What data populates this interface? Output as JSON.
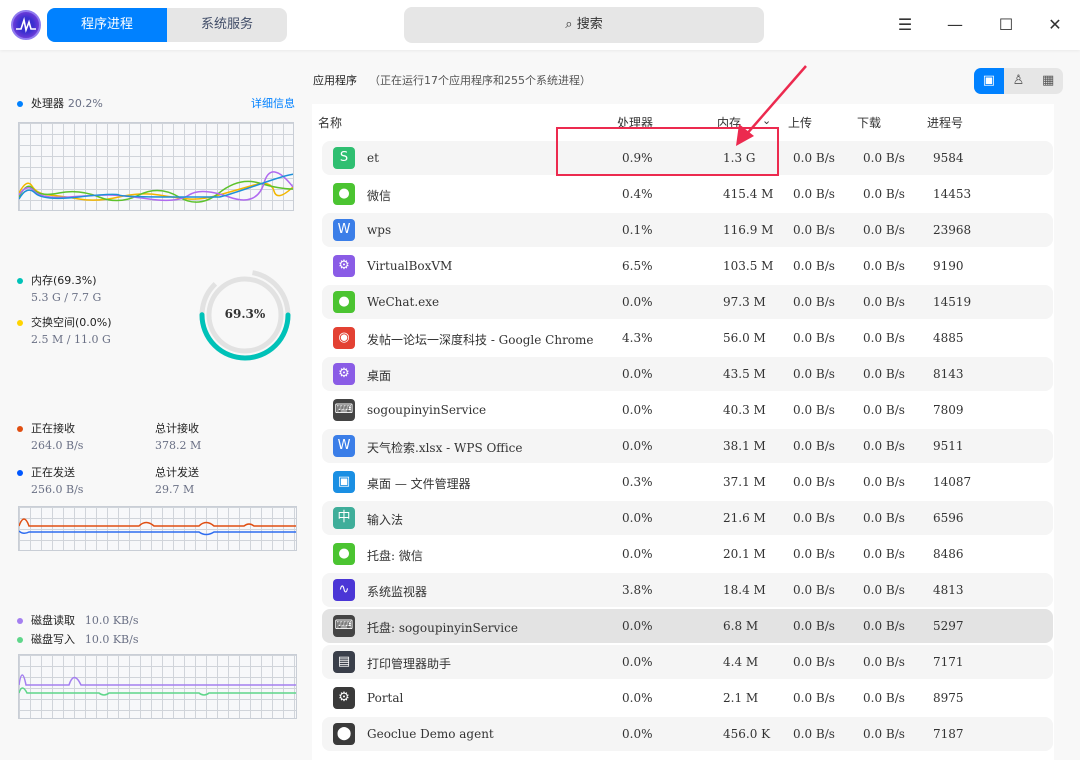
{
  "titlebar": {
    "tabs": [
      "程序进程",
      "系统服务"
    ],
    "search": "搜索",
    "menu": "☰",
    "min": "—",
    "max": "☐",
    "close": "✕"
  },
  "cpu": {
    "label": "处理器",
    "value": "20.2%",
    "detail": "详细信息"
  },
  "memory": {
    "label": "内存(69.3%)",
    "value": "5.3 G / 7.7 G",
    "swap_label": "交换空间(0.0%)",
    "swap_value": "2.5 M / 11.0 G",
    "ring_text": "69.3%",
    "percent": 69.3
  },
  "network": {
    "recv_label": "正在接收",
    "recv": "264.0 B/s",
    "total_recv_label": "总计接收",
    "total_recv": "378.2 M",
    "send_label": "正在发送",
    "send": "256.0 B/s",
    "total_send_label": "总计发送",
    "total_send": "29.7 M"
  },
  "disk": {
    "read_label": "磁盘读取",
    "read": "10.0 KB/s",
    "write_label": "磁盘写入",
    "write": "10.0 KB/s"
  },
  "main": {
    "title": "应用程序",
    "subtitle": "（正在运行17个应用程序和255个系统进程）",
    "columns": [
      "名称",
      "处理器",
      "内存",
      "上传",
      "下载",
      "进程号"
    ],
    "rows": [
      {
        "name": "et",
        "cpu": "0.9%",
        "mem": "1.3 G",
        "up": "0.0 B/s",
        "down": "0.0 B/s",
        "pid": "9584",
        "icon": "et-icon",
        "color": "#2fbf71",
        "glyph": "S"
      },
      {
        "name": "微信",
        "cpu": "0.4%",
        "mem": "415.4 M",
        "up": "0.0 B/s",
        "down": "0.0 B/s",
        "pid": "14453",
        "icon": "wechat-icon",
        "color": "#4bc431",
        "glyph": "●"
      },
      {
        "name": "wps",
        "cpu": "0.1%",
        "mem": "116.9 M",
        "up": "0.0 B/s",
        "down": "0.0 B/s",
        "pid": "23968",
        "icon": "wps-icon",
        "color": "#3b7ee8",
        "glyph": "W"
      },
      {
        "name": "VirtualBoxVM",
        "cpu": "6.5%",
        "mem": "103.5 M",
        "up": "0.0 B/s",
        "down": "0.0 B/s",
        "pid": "9190",
        "icon": "gear-app-icon",
        "color": "#8a5ce6",
        "glyph": "⚙"
      },
      {
        "name": "WeChat.exe",
        "cpu": "0.0%",
        "mem": "97.3 M",
        "up": "0.0 B/s",
        "down": "0.0 B/s",
        "pid": "14519",
        "icon": "wechat-icon",
        "color": "#4bc431",
        "glyph": "●"
      },
      {
        "name": "发帖一论坛一深度科技 - Google Chrome",
        "cpu": "4.3%",
        "mem": "56.0 M",
        "up": "0.0 B/s",
        "down": "0.0 B/s",
        "pid": "4885",
        "icon": "chrome-icon",
        "color": "#e34133",
        "glyph": "◉"
      },
      {
        "name": "桌面",
        "cpu": "0.0%",
        "mem": "43.5 M",
        "up": "0.0 B/s",
        "down": "0.0 B/s",
        "pid": "8143",
        "icon": "gear-app-icon",
        "color": "#8a5ce6",
        "glyph": "⚙"
      },
      {
        "name": "sogoupinyinService",
        "cpu": "0.0%",
        "mem": "40.3 M",
        "up": "0.0 B/s",
        "down": "0.0 B/s",
        "pid": "7809",
        "icon": "keyboard-icon",
        "color": "#444",
        "glyph": "⌨"
      },
      {
        "name": "天气检索.xlsx - WPS Office",
        "cpu": "0.0%",
        "mem": "38.1 M",
        "up": "0.0 B/s",
        "down": "0.0 B/s",
        "pid": "9511",
        "icon": "wps-icon",
        "color": "#3b7ee8",
        "glyph": "W"
      },
      {
        "name": "桌面 — 文件管理器",
        "cpu": "0.3%",
        "mem": "37.1 M",
        "up": "0.0 B/s",
        "down": "0.0 B/s",
        "pid": "14087",
        "icon": "file-manager-icon",
        "color": "#1a8fe3",
        "glyph": "▣"
      },
      {
        "name": "输入法",
        "cpu": "0.0%",
        "mem": "21.6 M",
        "up": "0.0 B/s",
        "down": "0.0 B/s",
        "pid": "6596",
        "icon": "input-method-icon",
        "color": "#3fae9a",
        "glyph": "中"
      },
      {
        "name": "托盘: 微信",
        "cpu": "0.0%",
        "mem": "20.1 M",
        "up": "0.0 B/s",
        "down": "0.0 B/s",
        "pid": "8486",
        "icon": "wechat-icon",
        "color": "#4bc431",
        "glyph": "●"
      },
      {
        "name": "系统监视器",
        "cpu": "3.8%",
        "mem": "18.4 M",
        "up": "0.0 B/s",
        "down": "0.0 B/s",
        "pid": "4813",
        "icon": "system-monitor-icon",
        "color": "#4b36d6",
        "glyph": "∿"
      },
      {
        "name": "托盘: sogoupinyinService",
        "cpu": "0.0%",
        "mem": "6.8 M",
        "up": "0.0 B/s",
        "down": "0.0 B/s",
        "pid": "5297",
        "icon": "keyboard-icon",
        "color": "#444",
        "glyph": "⌨"
      },
      {
        "name": "打印管理器助手",
        "cpu": "0.0%",
        "mem": "4.4 M",
        "up": "0.0 B/s",
        "down": "0.0 B/s",
        "pid": "7171",
        "icon": "printer-icon",
        "color": "#3a3f4a",
        "glyph": "▤"
      },
      {
        "name": "Portal",
        "cpu": "0.0%",
        "mem": "2.1 M",
        "up": "0.0 B/s",
        "down": "0.0 B/s",
        "pid": "8975",
        "icon": "gear-icon",
        "color": "#3a3a3a",
        "glyph": "⚙"
      },
      {
        "name": "Geoclue Demo agent",
        "cpu": "0.0%",
        "mem": "456.0 K",
        "up": "0.0 B/s",
        "down": "0.0 B/s",
        "pid": "7187",
        "icon": "location-pin-icon",
        "color": "#3a3a3a",
        "glyph": "⬤"
      }
    ]
  },
  "colors": {
    "accent": "#0081ff",
    "highlight": "#ec2a4f",
    "memory": "#00c2b8",
    "swap": "#ffd400",
    "recv": "#e04e11",
    "send": "#0057ff",
    "disk_read": "#a47ff0",
    "disk_write": "#5fd68a"
  }
}
